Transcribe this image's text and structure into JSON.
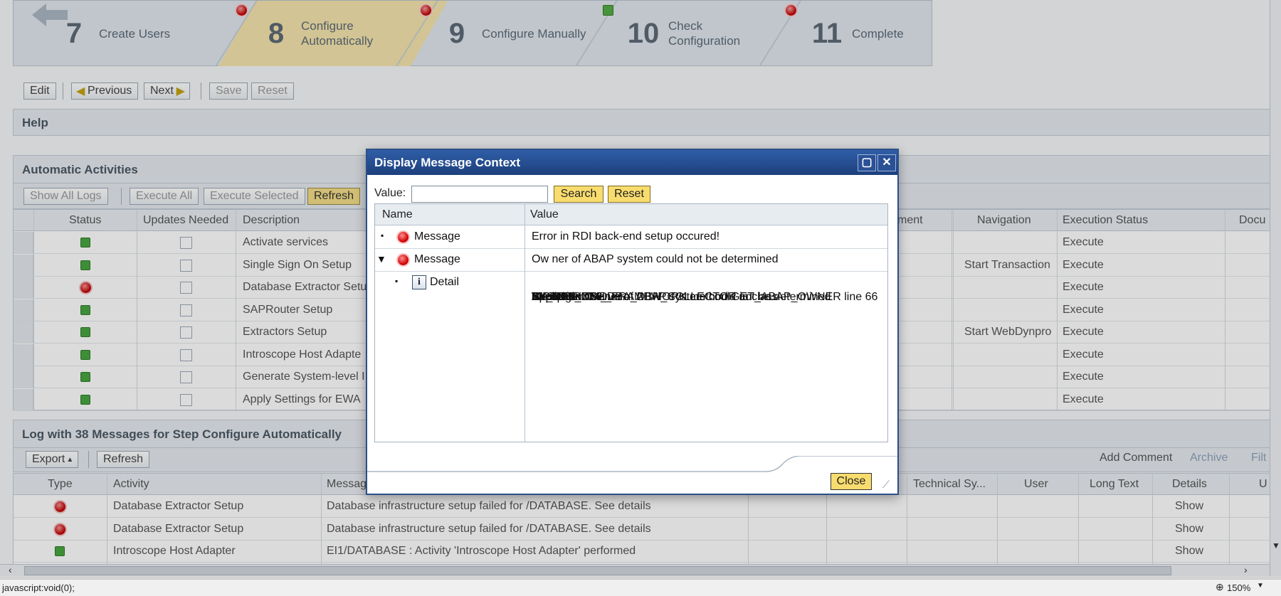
{
  "wizard": {
    "steps": [
      {
        "num": "7",
        "label1": "Create Users",
        "label2": "",
        "status": "error"
      },
      {
        "num": "8",
        "label1": "Configure",
        "label2": "Automatically",
        "status": "error"
      },
      {
        "num": "9",
        "label1": "Configure Manually",
        "label2": "",
        "status": "ok"
      },
      {
        "num": "10",
        "label1": "Check",
        "label2": "Configuration",
        "status": "error"
      },
      {
        "num": "11",
        "label1": "Complete",
        "label2": "",
        "status": "none"
      }
    ]
  },
  "toolbar": {
    "edit": "Edit",
    "previous": "Previous",
    "next": "Next",
    "save": "Save",
    "reset": "Reset"
  },
  "help": {
    "title": "Help"
  },
  "activities": {
    "title": "Automatic Activities",
    "show_all_logs": "Show  All Logs",
    "execute_all": "Execute All",
    "execute_selected": "Execute Selected",
    "refresh": "Refresh",
    "headers": {
      "status": "Status",
      "updates": "Updates Needed",
      "description": "Description",
      "comment": "ment",
      "navigation": "Navigation",
      "execution": "Execution Status",
      "docu": "Docu"
    },
    "rows": [
      {
        "status": "ok",
        "description": "Activate services",
        "navigation": "",
        "execution": "Execute"
      },
      {
        "status": "ok",
        "description": "Single Sign On Setup",
        "navigation": "Start Transaction",
        "execution": "Execute"
      },
      {
        "status": "error",
        "description": "Database Extractor Setu",
        "navigation": "",
        "execution": "Execute"
      },
      {
        "status": "ok",
        "description": "SAPRouter Setup",
        "navigation": "",
        "execution": "Execute"
      },
      {
        "status": "ok",
        "description": "Extractors Setup",
        "navigation": "Start WebDynpro",
        "execution": "Execute"
      },
      {
        "status": "ok",
        "description": "Introscope Host Adapte",
        "navigation": "",
        "execution": "Execute"
      },
      {
        "status": "ok",
        "description": "Generate System-level I",
        "navigation": "",
        "execution": "Execute"
      },
      {
        "status": "ok",
        "description": "Apply Settings for EWA",
        "navigation": "",
        "execution": "Execute"
      }
    ]
  },
  "log": {
    "title": "Log with 38 Messages for Step Configure Automatically",
    "export": "Export",
    "refresh": "Refresh",
    "add_comment": "Add Comment",
    "archive": "Archive",
    "filter": "Filt",
    "headers": {
      "type": "Type",
      "activity": "Activity",
      "message": "Messag",
      "technical": "Technical Sy...",
      "user": "User",
      "longtext": "Long Text",
      "details": "Details",
      "u": "U"
    },
    "rows": [
      {
        "type": "error",
        "activity": "Database Extractor Setup",
        "message": "Database infrastructure setup failed for      /DATABASE. See details",
        "details": "Show"
      },
      {
        "type": "error",
        "activity": "Database Extractor Setup",
        "message": "Database infrastructure setup failed for      /DATABASE. See details",
        "details": "Show"
      },
      {
        "type": "ok",
        "activity": "Introscope Host Adapter",
        "message": "EI1/DATABASE : Activity 'Introscope Host Adapter' performed",
        "details": "Show"
      }
    ]
  },
  "dialog": {
    "title": "Display Message Context",
    "value_label": "Value:",
    "value_input": "",
    "search": "Search",
    "reset": "Reset",
    "col_name": "Name",
    "col_value": "Value",
    "rows": [
      {
        "name": "Message",
        "value": "Error in RDI back-end setup occured!"
      },
      {
        "name": "Message",
        "value": "Ow ner of ABAP system could not be determined"
      }
    ],
    "detail_name": "Detail",
    "detail_lines": [
      "Exception CX_DBA_DBH_COLLECTOR in class",
      "CL_DB6_DBH_FRAMEWORK method GET_ABAP_OWNER line 66",
      "Kernel Error ID:",
      "WP ID:",
      "WP PID:",
      "Application Server:",
      "SYSID:",
      "SY-SUBRC: 0",
      "SY-TABIX: 0",
      "Message: Ow ner of ABAP system could not be determined"
    ],
    "close": "Close"
  },
  "statusbar": {
    "text": "javascript:void(0);",
    "zoom": "150%"
  }
}
